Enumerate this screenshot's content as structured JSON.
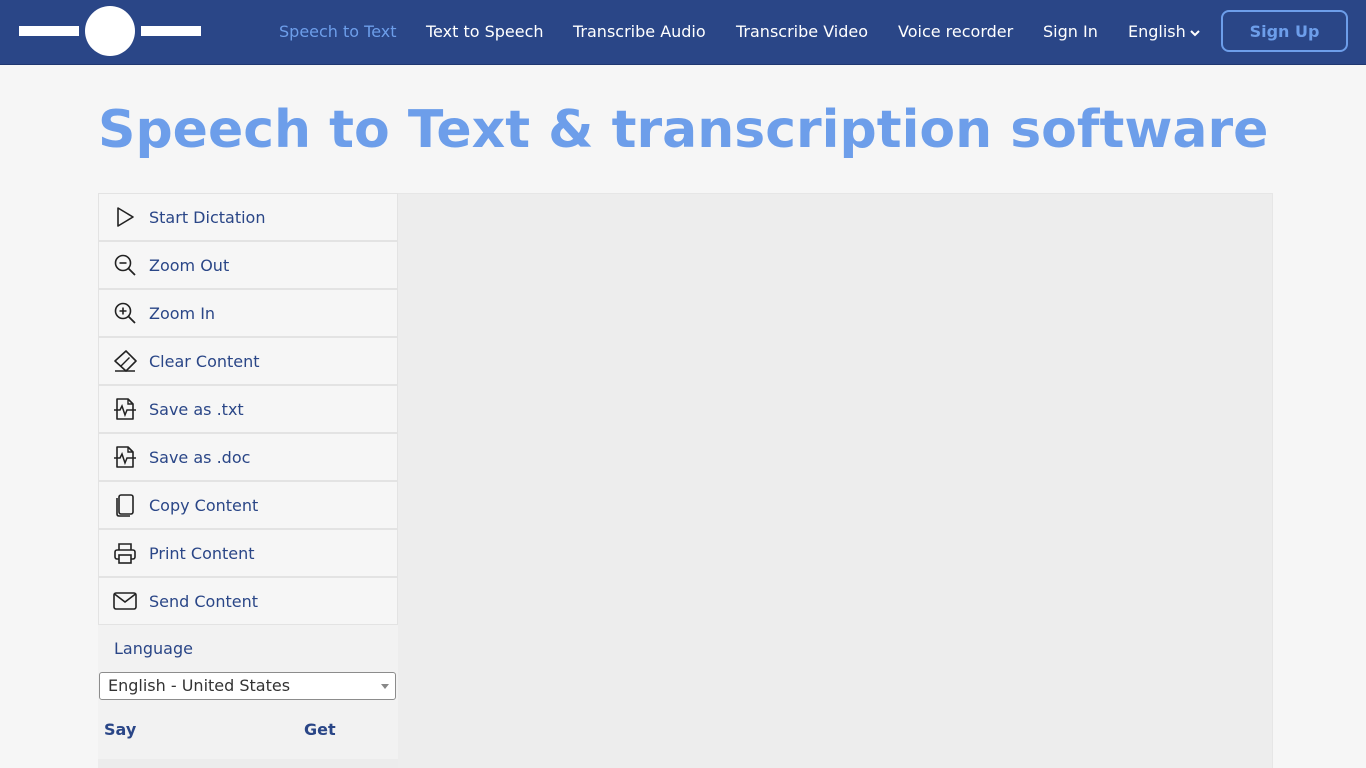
{
  "nav": {
    "items": [
      {
        "label": "Speech to Text",
        "active": true
      },
      {
        "label": "Text to Speech"
      },
      {
        "label": "Transcribe Audio"
      },
      {
        "label": "Transcribe Video"
      },
      {
        "label": "Voice recorder"
      },
      {
        "label": "Sign In"
      }
    ],
    "language": "English",
    "signup_label": "Sign Up"
  },
  "title": "Speech to Text & transcription software",
  "sidebar": {
    "items": [
      {
        "label": "Start Dictation",
        "icon": "play-icon"
      },
      {
        "label": "Zoom Out",
        "icon": "zoom-out-icon"
      },
      {
        "label": "Zoom In",
        "icon": "zoom-in-icon"
      },
      {
        "label": "Clear Content",
        "icon": "eraser-icon"
      },
      {
        "label": "Save as .txt",
        "icon": "file-pulse-icon"
      },
      {
        "label": "Save as .doc",
        "icon": "file-pulse-icon"
      },
      {
        "label": "Copy Content",
        "icon": "copy-icon"
      },
      {
        "label": "Print Content",
        "icon": "printer-icon"
      },
      {
        "label": "Send Content",
        "icon": "envelope-icon"
      }
    ],
    "language_label": "Language",
    "language_selected": "English - United States",
    "commands_headers": {
      "say": "Say",
      "get": "Get"
    }
  },
  "colors": {
    "header_bg": "#2a4687",
    "accent": "#6d9eea",
    "text": "#2a4687"
  }
}
